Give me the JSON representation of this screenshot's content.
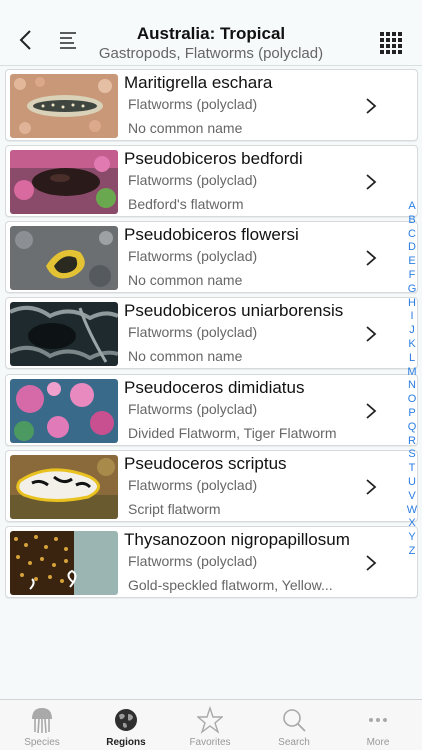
{
  "header": {
    "title": "Australia: Tropical",
    "subtitle": "Gastropods, Flatworms (polyclad)"
  },
  "species": [
    {
      "name": "Maritigrella eschara",
      "group": "Flatworms (polyclad)",
      "common": "No common name"
    },
    {
      "name": "Pseudobiceros bedfordi",
      "group": "Flatworms (polyclad)",
      "common": "Bedford's flatworm"
    },
    {
      "name": "Pseudobiceros flowersi",
      "group": "Flatworms (polyclad)",
      "common": "No common name"
    },
    {
      "name": "Pseudobiceros uniarborensis",
      "group": "Flatworms (polyclad)",
      "common": "No common name"
    },
    {
      "name": "Pseudoceros dimidiatus",
      "group": "Flatworms (polyclad)",
      "common": "Divided Flatworm, Tiger Flatworm"
    },
    {
      "name": "Pseudoceros scriptus",
      "group": "Flatworms (polyclad)",
      "common": "Script flatworm"
    },
    {
      "name": "Thysanozoon nigropapillosum",
      "group": "Flatworms (polyclad)",
      "common": "Gold-speckled flatworm, Yellow..."
    }
  ],
  "index_letters": [
    "A",
    "B",
    "C",
    "D",
    "E",
    "F",
    "G",
    "H",
    "I",
    "J",
    "K",
    "L",
    "M",
    "N",
    "O",
    "P",
    "Q",
    "R",
    "S",
    "T",
    "U",
    "V",
    "W",
    "X",
    "Y",
    "Z"
  ],
  "tabs": [
    {
      "label": "Species",
      "icon": "jellyfish-icon"
    },
    {
      "label": "Regions",
      "icon": "globe-icon"
    },
    {
      "label": "Favorites",
      "icon": "star-icon"
    },
    {
      "label": "Search",
      "icon": "search-icon"
    },
    {
      "label": "More",
      "icon": "more-icon"
    }
  ],
  "active_tab": "Regions",
  "colors": {
    "accent": "#2a7de1",
    "text": "#111111",
    "secondary": "#666666"
  }
}
